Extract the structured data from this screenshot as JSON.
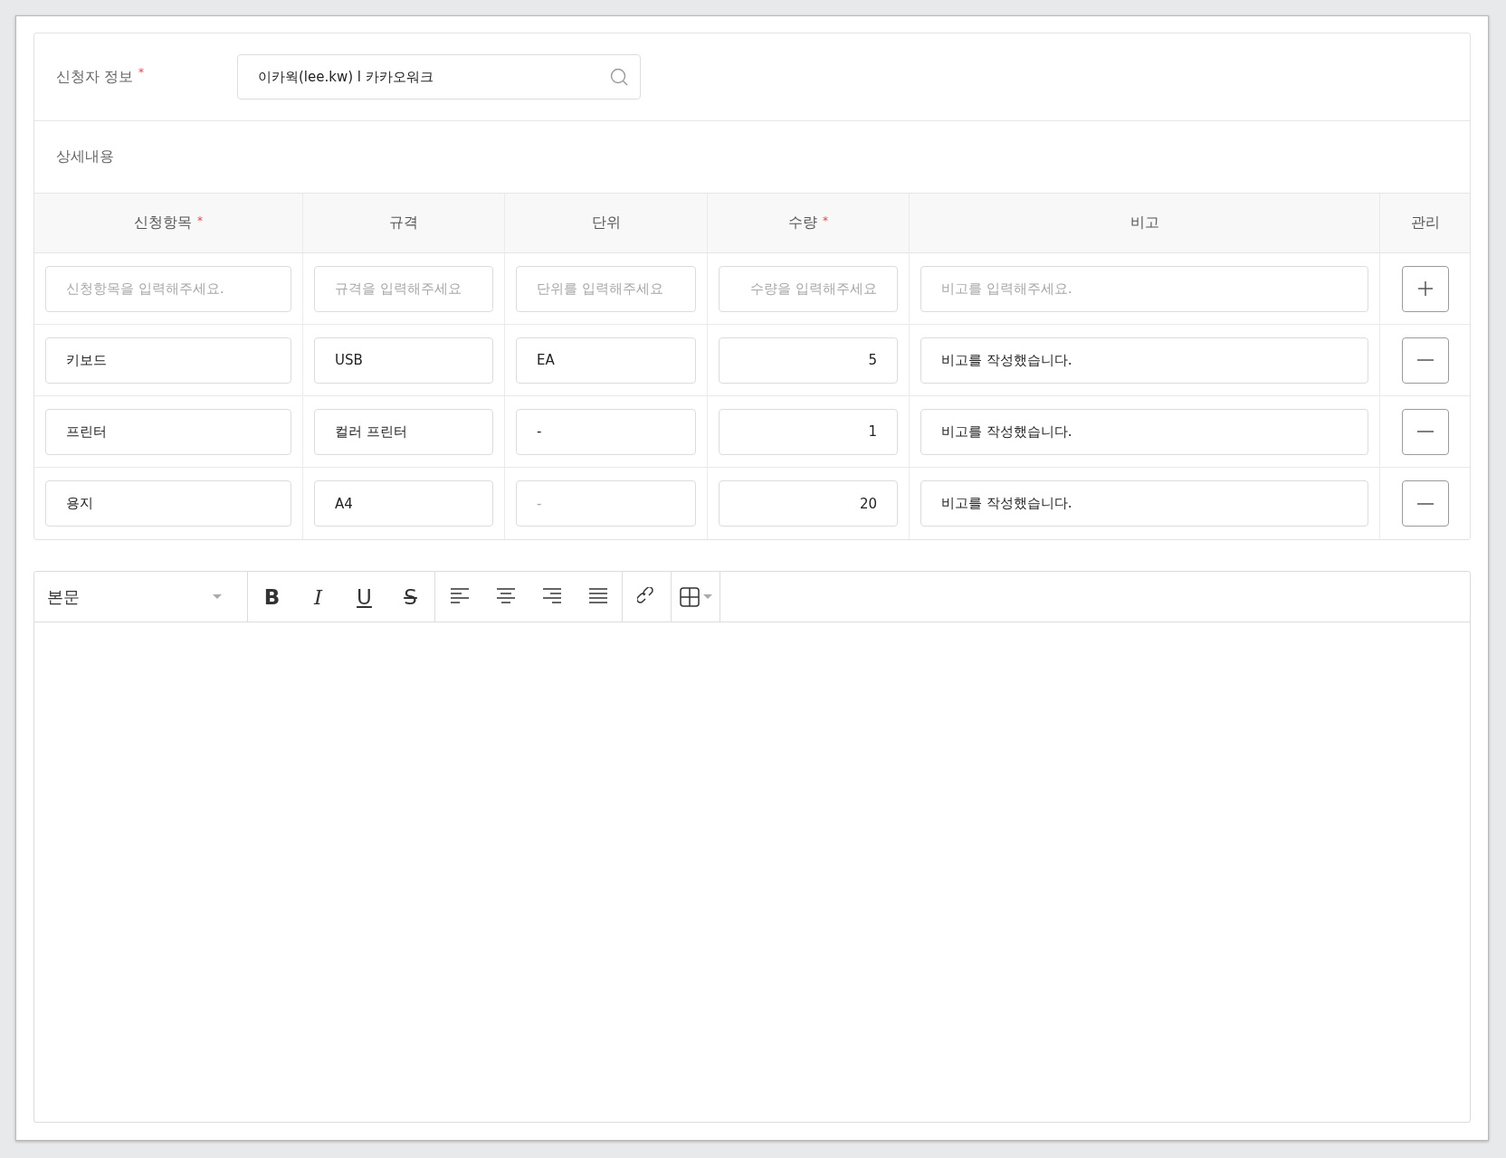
{
  "requester": {
    "label": "신청자 정보",
    "required_mark": "*",
    "value": "이카웍(lee.kw) l 카카오워크"
  },
  "details": {
    "title": "상세내용",
    "columns": [
      {
        "label": "신청항목",
        "required_mark": "*",
        "kind": "text"
      },
      {
        "label": "규격",
        "kind": "text"
      },
      {
        "label": "단위",
        "kind": "text"
      },
      {
        "label": "수량",
        "required_mark": "*",
        "kind": "number"
      },
      {
        "label": "비고",
        "kind": "text"
      },
      {
        "label": "관리",
        "kind": "action"
      }
    ],
    "rows": [
      {
        "cells": [
          {
            "placeholder": "신청항목을 입력해주세요."
          },
          {
            "placeholder": "규격을 입력해주세요"
          },
          {
            "placeholder": "단위를 입력해주세요"
          },
          {
            "placeholder": "수량을 입력해주세요"
          },
          {
            "placeholder": "비고를 입력해주세요."
          }
        ],
        "action": {
          "kind": "add"
        }
      },
      {
        "cells": [
          {
            "value": "키보드"
          },
          {
            "value": "USB"
          },
          {
            "value": "EA"
          },
          {
            "value": "5"
          },
          {
            "value": "비고를 작성했습니다."
          }
        ],
        "action": {
          "kind": "remove"
        }
      },
      {
        "cells": [
          {
            "value": "프린터"
          },
          {
            "value": "컬러 프린터"
          },
          {
            "value": "-"
          },
          {
            "value": "1"
          },
          {
            "value": "비고를 작성했습니다."
          }
        ],
        "action": {
          "kind": "remove"
        }
      },
      {
        "cells": [
          {
            "value": "용지"
          },
          {
            "value": "A4"
          },
          {
            "placeholder": "-"
          },
          {
            "value": "20"
          },
          {
            "value": "비고를 작성했습니다."
          }
        ],
        "action": {
          "kind": "remove"
        }
      }
    ]
  },
  "editor": {
    "style": "본문",
    "tool_groups": [
      [
        {
          "kind": "bold",
          "glyph": "B"
        },
        {
          "kind": "italic",
          "glyph": "I"
        },
        {
          "kind": "underline",
          "glyph": "U"
        },
        {
          "kind": "strike",
          "glyph": "S"
        }
      ],
      [
        {
          "kind": "align-left"
        },
        {
          "kind": "align-center"
        },
        {
          "kind": "align-right"
        },
        {
          "kind": "justify"
        }
      ],
      [
        {
          "kind": "link"
        }
      ],
      [
        {
          "kind": "table"
        }
      ]
    ]
  }
}
